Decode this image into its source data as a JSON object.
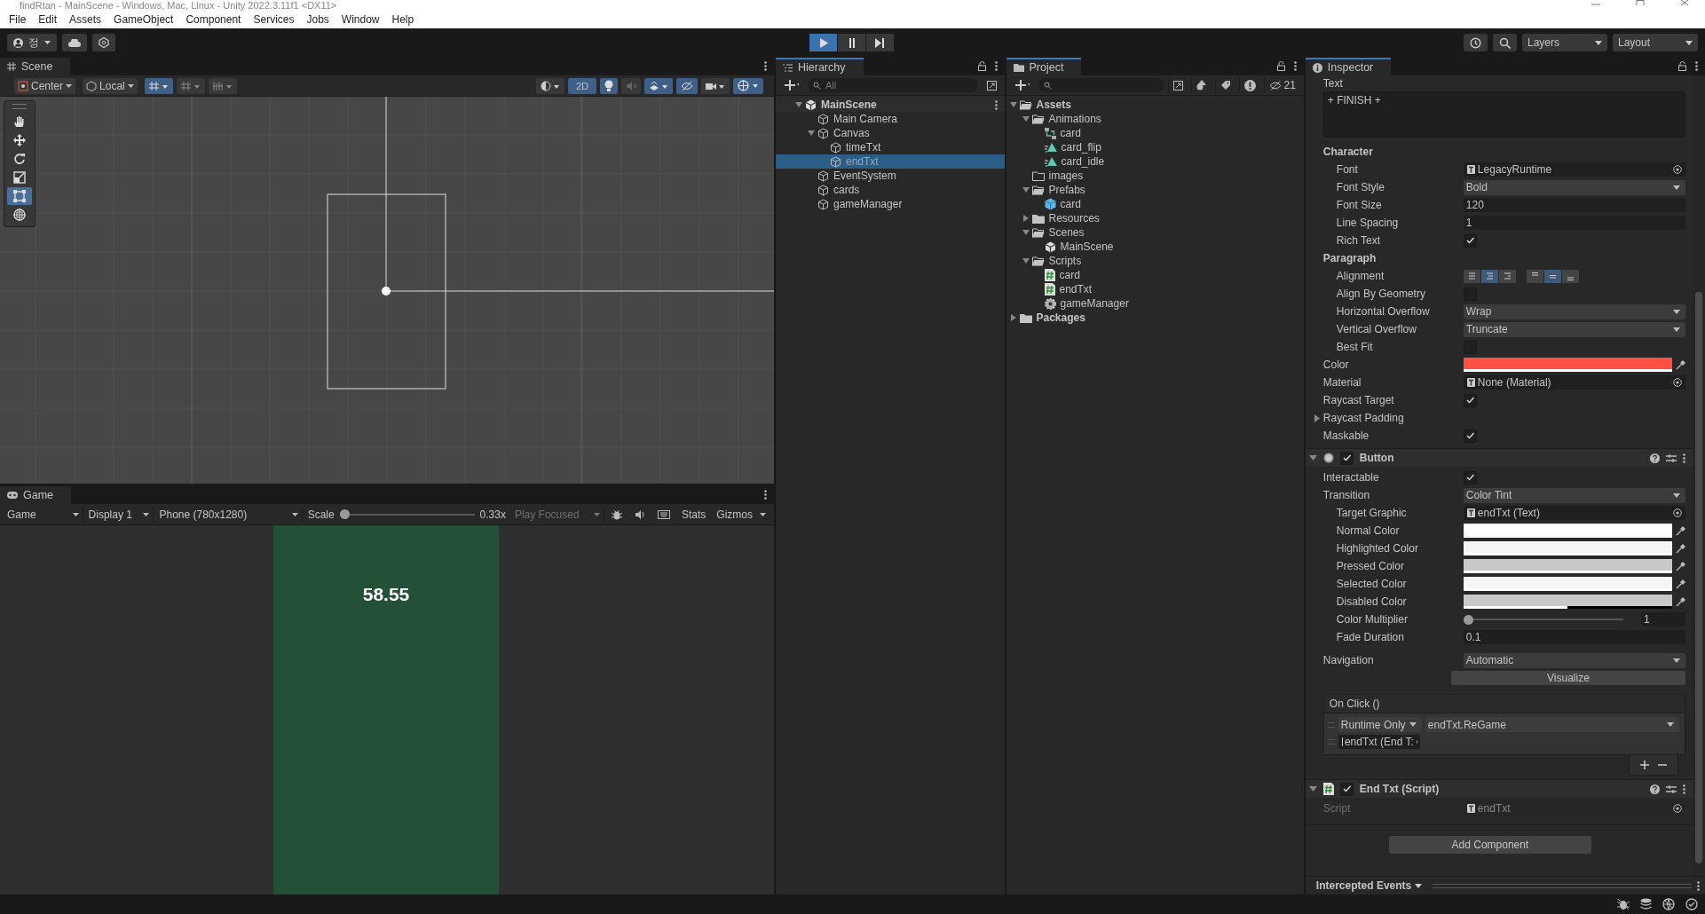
{
  "window": {
    "title": "findRtan - MainScene - Windows, Mac, Linux - Unity 2022.3.11f1 <DX11>"
  },
  "menu": [
    "File",
    "Edit",
    "Assets",
    "GameObject",
    "Component",
    "Services",
    "Jobs",
    "Window",
    "Help"
  ],
  "toolbar": {
    "account": "정",
    "play_controls": [
      {
        "kind": "play",
        "selected": true
      },
      {
        "kind": "pause",
        "selected": false
      },
      {
        "kind": "step",
        "selected": false
      }
    ],
    "layers": "Layers",
    "layout": "Layout"
  },
  "scene": {
    "tab": "Scene",
    "pivot": "Center",
    "space": "Local",
    "mode_2d": {
      "label": "2D",
      "on": true
    },
    "tools": [
      {
        "kind": "hand",
        "selected": false
      },
      {
        "kind": "move",
        "selected": false
      },
      {
        "kind": "rotate",
        "selected": false
      },
      {
        "kind": "scale",
        "selected": false
      },
      {
        "kind": "rect",
        "selected": true
      },
      {
        "kind": "transform",
        "selected": false
      }
    ]
  },
  "game": {
    "tab": "Game",
    "view": "Game",
    "display": "Display 1",
    "resolution": "Phone (780x1280)",
    "scale_label": "Scale",
    "scale": {
      "level": 0,
      "reading": "0.33x"
    },
    "play_mode": "Play Focused",
    "stats": "Stats",
    "gizmos": "Gizmos",
    "timer": "58.55"
  },
  "hierarchy": {
    "tab": "Hierarchy",
    "placeholder": "All",
    "tree": [
      {
        "label": "MainScene",
        "kind": "scene",
        "selected": false,
        "expanded": true,
        "children": [
          {
            "label": "Main Camera",
            "kind": "object",
            "selected": false
          },
          {
            "label": "Canvas",
            "kind": "object",
            "selected": false,
            "expanded": true,
            "children": [
              {
                "label": "timeTxt",
                "kind": "object",
                "selected": false
              },
              {
                "label": "endTxt",
                "kind": "object",
                "selected": true
              }
            ]
          },
          {
            "label": "EventSystem",
            "kind": "object",
            "selected": false
          },
          {
            "label": "cards",
            "kind": "object",
            "selected": false
          },
          {
            "label": "gameManager",
            "kind": "object",
            "selected": false
          }
        ]
      }
    ]
  },
  "project": {
    "tab": "Project",
    "hidden_count": "21",
    "tree": [
      {
        "label": "Assets",
        "kind": "folder",
        "expanded": true,
        "children": [
          {
            "label": "Animations",
            "kind": "folder",
            "expanded": true,
            "children": [
              {
                "label": "card",
                "kind": "controller"
              },
              {
                "label": "card_flip",
                "kind": "anim"
              },
              {
                "label": "card_idle",
                "kind": "anim"
              }
            ]
          },
          {
            "label": "images",
            "kind": "folder"
          },
          {
            "label": "Prefabs",
            "kind": "folder",
            "expanded": true,
            "children": [
              {
                "label": "card",
                "kind": "prefab"
              }
            ]
          },
          {
            "label": "Resources",
            "kind": "folder",
            "expanded": false
          },
          {
            "label": "Scenes",
            "kind": "folder",
            "expanded": true,
            "children": [
              {
                "label": "MainScene",
                "kind": "scene"
              }
            ]
          },
          {
            "label": "Scripts",
            "kind": "folder",
            "expanded": true,
            "children": [
              {
                "label": "card",
                "kind": "script"
              },
              {
                "label": "endTxt",
                "kind": "script"
              },
              {
                "label": "gameManager",
                "kind": "settings"
              }
            ]
          }
        ]
      },
      {
        "label": "Packages",
        "kind": "folder",
        "expanded": false
      }
    ]
  },
  "inspector": {
    "tab": "Inspector",
    "text_label": "Text",
    "text_value": "+ FINISH +",
    "rows": [
      {
        "kind": "heading",
        "label": "Character"
      },
      {
        "kind": "object",
        "label": "Font",
        "value": "LegacyRuntime",
        "indent": true,
        "disabled": false
      },
      {
        "kind": "dropdown",
        "label": "Font Style",
        "value": "Bold",
        "indent": true
      },
      {
        "kind": "field",
        "label": "Font Size",
        "value": "120",
        "indent": true
      },
      {
        "kind": "field",
        "label": "Line Spacing",
        "value": "1",
        "indent": true
      },
      {
        "kind": "checkbox",
        "label": "Rich Text",
        "checked": true,
        "indent": true
      },
      {
        "kind": "heading",
        "label": "Paragraph"
      },
      {
        "kind": "alignment",
        "label": "Alignment",
        "indent": true,
        "horizontal": [
          {
            "selected": false
          },
          {
            "selected": true
          },
          {
            "selected": false
          }
        ],
        "vertical": [
          {
            "selected": false
          },
          {
            "selected": true
          },
          {
            "selected": false
          }
        ]
      },
      {
        "kind": "checkbox",
        "label": "Align By Geometry",
        "checked": false,
        "indent": true
      },
      {
        "kind": "dropdown",
        "label": "Horizontal Overflow",
        "value": "Wrap",
        "indent": true
      },
      {
        "kind": "dropdown",
        "label": "Vertical Overflow",
        "value": "Truncate",
        "indent": true
      },
      {
        "kind": "checkbox",
        "label": "Best Fit",
        "checked": false,
        "indent": true
      },
      {
        "kind": "color",
        "label": "Color",
        "color": "#ff5143",
        "level": 1,
        "indent": false
      },
      {
        "kind": "object",
        "label": "Material",
        "value": "None (Material)",
        "indent": false,
        "disabled": false
      },
      {
        "kind": "checkbox",
        "label": "Raycast Target",
        "checked": true,
        "indent": false
      },
      {
        "kind": "foldout",
        "label": "Raycast Padding",
        "expanded": false
      },
      {
        "kind": "checkbox",
        "label": "Maskable",
        "checked": true,
        "indent": false
      }
    ],
    "components": [
      {
        "title": "Button",
        "kind": "button",
        "enabled": true,
        "expanded": true,
        "rows": [
          {
            "kind": "checkbox",
            "label": "Interactable",
            "checked": true,
            "indent": false
          },
          {
            "kind": "dropdown",
            "label": "Transition",
            "value": "Color Tint",
            "indent": false
          },
          {
            "kind": "object",
            "label": "Target Graphic",
            "value": "endTxt (Text)",
            "indent": true,
            "disabled": false
          },
          {
            "kind": "color",
            "label": "Normal Color",
            "color": "#ffffff",
            "level": 1,
            "indent": true
          },
          {
            "kind": "color",
            "label": "Highlighted Color",
            "color": "#f5f5f5",
            "level": 1,
            "indent": true
          },
          {
            "kind": "color",
            "label": "Pressed Color",
            "color": "#c8c8c8",
            "level": 1,
            "indent": true
          },
          {
            "kind": "color",
            "label": "Selected Color",
            "color": "#f5f5f5",
            "level": 1,
            "indent": true
          },
          {
            "kind": "color",
            "label": "Disabled Color",
            "color": "#c8c8c8",
            "level": 0.5,
            "indent": true
          },
          {
            "kind": "slider",
            "label": "Color Multiplier",
            "level": 0,
            "value": "1",
            "indent": true
          },
          {
            "kind": "field",
            "label": "Fade Duration",
            "value": "0.1",
            "indent": true
          },
          {
            "kind": "dropdown",
            "label": "Navigation",
            "value": "Automatic",
            "indent": false
          },
          {
            "kind": "button",
            "label": "Visualize"
          },
          {
            "kind": "event",
            "title": "On Click ()",
            "mode": "Runtime Only",
            "function": "endTxt.ReGame",
            "target": "endTxt (End T:"
          }
        ]
      },
      {
        "title": "End Txt (Script)",
        "kind": "script",
        "enabled": true,
        "expanded": true,
        "rows": [
          {
            "kind": "object",
            "label": "Script",
            "value": "endTxt",
            "indent": false,
            "disabled": true
          }
        ]
      }
    ],
    "add_component": "Add Component",
    "intercepted": "Intercepted Events"
  }
}
